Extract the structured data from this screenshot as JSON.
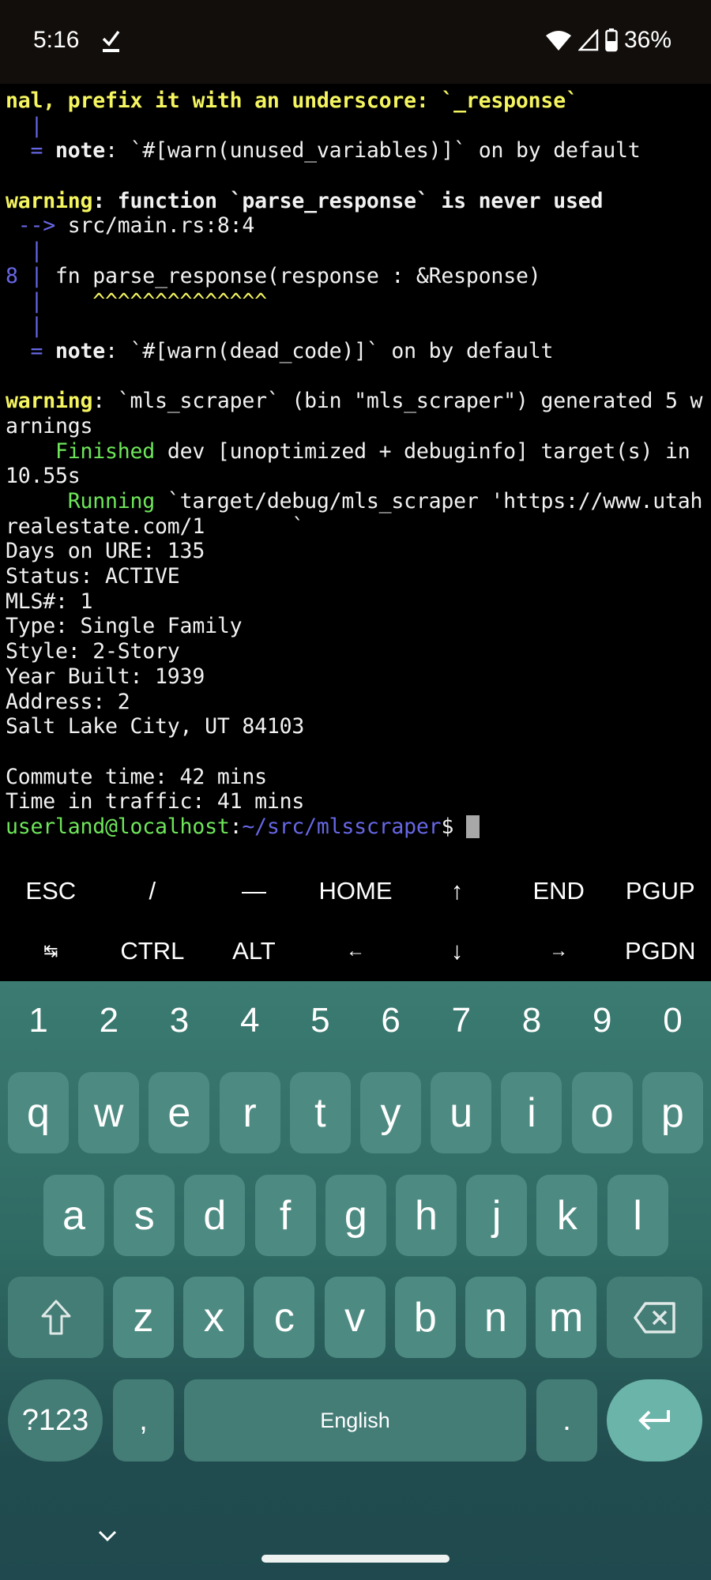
{
  "status_bar": {
    "time": "5:16",
    "notification_icon": "download-done-icon",
    "wifi_icon": "wifi-icon",
    "signal_icon": "cell-signal-icon",
    "battery_icon": "battery-icon",
    "battery_percent": "36%"
  },
  "terminal": {
    "lines": [
      [
        {
          "t": "nal, prefix it with an underscore: `_response`",
          "c": "y bold"
        }
      ],
      [
        {
          "t": "  |",
          "c": "b"
        }
      ],
      [
        {
          "t": "  = ",
          "c": "b"
        },
        {
          "t": "note",
          "c": "w bold"
        },
        {
          "t": ": `#[warn(unused_variables)]` on by default",
          "c": "w"
        }
      ],
      [
        {
          "t": "",
          "c": "w"
        }
      ],
      [
        {
          "t": "warning",
          "c": "y bold"
        },
        {
          "t": ": function `parse_response` is never used",
          "c": "w bold"
        }
      ],
      [
        {
          "t": " --> ",
          "c": "b"
        },
        {
          "t": "src/main.rs:8:4",
          "c": "w"
        }
      ],
      [
        {
          "t": "  |",
          "c": "b"
        }
      ],
      [
        {
          "t": "8 | ",
          "c": "b"
        },
        {
          "t": "fn parse_response(response : &Response)",
          "c": "w"
        }
      ],
      [
        {
          "t": "  |    ",
          "c": "b"
        },
        {
          "t": "^^^^^^^^^^^^^^",
          "c": "y"
        }
      ],
      [
        {
          "t": "  |",
          "c": "b"
        }
      ],
      [
        {
          "t": "  = ",
          "c": "b"
        },
        {
          "t": "note",
          "c": "w bold"
        },
        {
          "t": ": `#[warn(dead_code)]` on by default",
          "c": "w"
        }
      ],
      [
        {
          "t": "",
          "c": "w"
        }
      ],
      [
        {
          "t": "warning",
          "c": "y bold"
        },
        {
          "t": ": `mls_scraper` (bin \"mls_scraper\") generated 5 w",
          "c": "w"
        }
      ],
      [
        {
          "t": "arnings",
          "c": "w"
        }
      ],
      [
        {
          "t": "    Finished",
          "c": "g"
        },
        {
          "t": " dev [unoptimized + debuginfo] target(s) in",
          "c": "w"
        }
      ],
      [
        {
          "t": "10.55s",
          "c": "w"
        }
      ],
      [
        {
          "t": "     Running",
          "c": "g"
        },
        {
          "t": " `target/debug/mls_scraper 'https://www.utah",
          "c": "w"
        }
      ],
      [
        {
          "t": "realestate.com/1       `",
          "c": "w"
        }
      ],
      [
        {
          "t": "Days on URE: 135",
          "c": "w"
        }
      ],
      [
        {
          "t": "Status: ACTIVE",
          "c": "w"
        }
      ],
      [
        {
          "t": "MLS#: 1",
          "c": "w"
        }
      ],
      [
        {
          "t": "Type: Single Family",
          "c": "w"
        }
      ],
      [
        {
          "t": "Style: 2-Story",
          "c": "w"
        }
      ],
      [
        {
          "t": "Year Built: 1939",
          "c": "w"
        }
      ],
      [
        {
          "t": "Address: 2",
          "c": "w"
        }
      ],
      [
        {
          "t": "Salt Lake City, UT 84103",
          "c": "w"
        }
      ],
      [
        {
          "t": "",
          "c": "w"
        }
      ],
      [
        {
          "t": "Commute time: 42 mins",
          "c": "w"
        }
      ],
      [
        {
          "t": "Time in traffic: 41 mins",
          "c": "w"
        }
      ]
    ],
    "prompt": {
      "user_host": "userland@localhost",
      "separator": ":",
      "path": "~/src/mlsscraper",
      "symbol": "$ "
    }
  },
  "extra_keys": {
    "row1": [
      "ESC",
      "/",
      "—",
      "HOME",
      "↑",
      "END",
      "PGUP"
    ],
    "row2": [
      "↹",
      "CTRL",
      "ALT",
      "←",
      "↓",
      "→",
      "PGDN"
    ]
  },
  "keyboard": {
    "numbers": [
      "1",
      "2",
      "3",
      "4",
      "5",
      "6",
      "7",
      "8",
      "9",
      "0"
    ],
    "row1": [
      "q",
      "w",
      "e",
      "r",
      "t",
      "y",
      "u",
      "i",
      "o",
      "p"
    ],
    "row2": [
      "a",
      "s",
      "d",
      "f",
      "g",
      "h",
      "j",
      "k",
      "l"
    ],
    "row3": [
      "z",
      "x",
      "c",
      "v",
      "b",
      "n",
      "m"
    ],
    "symbols_key": "?123",
    "comma_key": ",",
    "space_label": "English",
    "period_key": ".",
    "shift_icon": "shift-icon",
    "backspace_icon": "backspace-icon",
    "enter_icon": "enter-icon"
  },
  "colors": {
    "terminal_bg": "#000000",
    "yellow": "#f5f560",
    "blue": "#6767e6",
    "green": "#6ee65a",
    "keyboard_bg": "#3b7b71",
    "key_bg": "#4d8b82",
    "enter_bg": "#6bb4a9"
  }
}
